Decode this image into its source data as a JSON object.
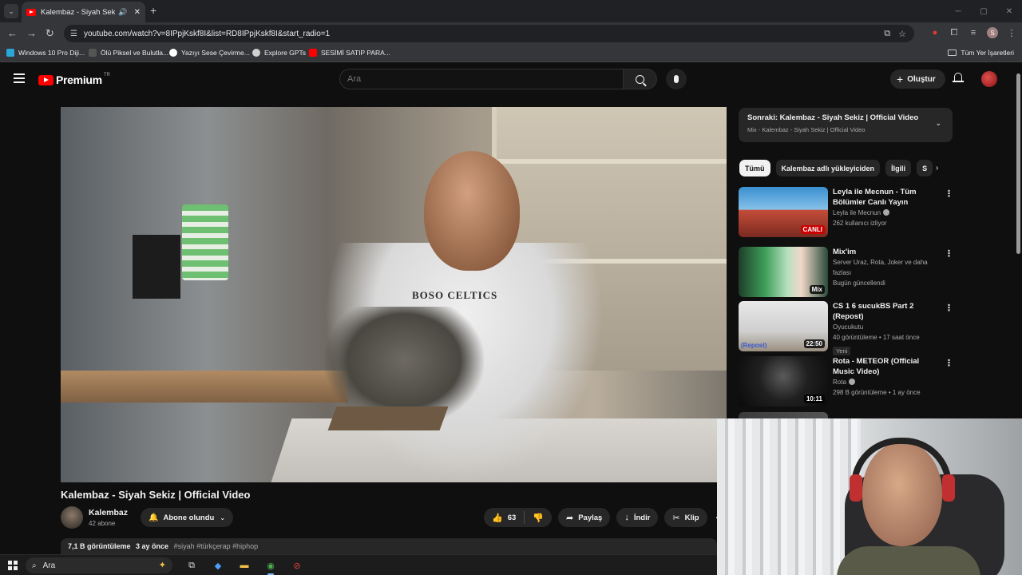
{
  "browser": {
    "tab_title": "Kalembaz - Siyah Sekiz | Offi",
    "url": "youtube.com/watch?v=8IPpjKskf8I&list=RD8IPpjKskf8I&start_radio=1",
    "bookmarks": [
      {
        "label": "Windows 10 Pro Diji...",
        "color": "#2aa7d8"
      },
      {
        "label": "Ölü Piksel ve Bulutla...",
        "color": "#555555"
      },
      {
        "label": "Yazıyı Sese Çevirme...",
        "color": "#ffffff"
      },
      {
        "label": "Explore GPTs",
        "color": "#cfcfcf"
      },
      {
        "label": "SESİMİ SATIP PARA...",
        "color": "#ff0000"
      }
    ],
    "all_bookmarks": "Tüm Yer İşaretleri",
    "profile_initial": "S"
  },
  "youtube": {
    "logo_text": "Premium",
    "country_code": "TR",
    "search_placeholder": "Ara",
    "create_label": "Oluştur"
  },
  "video": {
    "title": "Kalembaz - Siyah Sekiz | Official Video",
    "shirt_text": "BOSO CELTICS",
    "channel": "Kalembaz",
    "subscribers": "42 abone",
    "subscribe_label": "Abone olundu",
    "likes": "63",
    "share_label": "Paylaş",
    "download_label": "İndir",
    "clip_label": "Klip",
    "views": "7,1 B görüntüleme",
    "age": "3 ay önce",
    "tags": "#siyah #türkçerap #hiphop"
  },
  "playlist": {
    "title": "Sonraki: Kalembaz - Siyah Sekiz | Official Video",
    "subtitle": "Mix - Kalembaz - Siyah Sekiz | Official Video"
  },
  "chips": [
    "Tümü",
    "Kalembaz adlı yükleyiciden",
    "İlgili",
    "S"
  ],
  "recommendations": [
    {
      "title": "Leyla ile Mecnun - Tüm Bölümler Canlı Yayın",
      "channel": "Leyla ile Mecnun",
      "meta": "262 kullanıcı izliyor",
      "badge": "CANLI",
      "thumb_text": "CANLI"
    },
    {
      "title": "Mix'im",
      "channel": "Server Uraz, Rota, Joker ve daha fazlası",
      "meta": "Bugün güncellendi",
      "badge": "Mix"
    },
    {
      "title": "CS 1 6 sucukBS Part 2 (Repost)",
      "channel": "Oyucukutu",
      "meta": "40 görüntüleme • 17 saat önce",
      "badge": "22:50",
      "new_label": "Yeni",
      "thumb_text": "(Repost)"
    },
    {
      "title": "Rota - METEOR (Official Music Video)",
      "channel": "Rota",
      "meta": "298 B görüntüleme • 1 ay önce",
      "badge": "10:11"
    }
  ],
  "taskbar": {
    "search_label": "Ara"
  }
}
